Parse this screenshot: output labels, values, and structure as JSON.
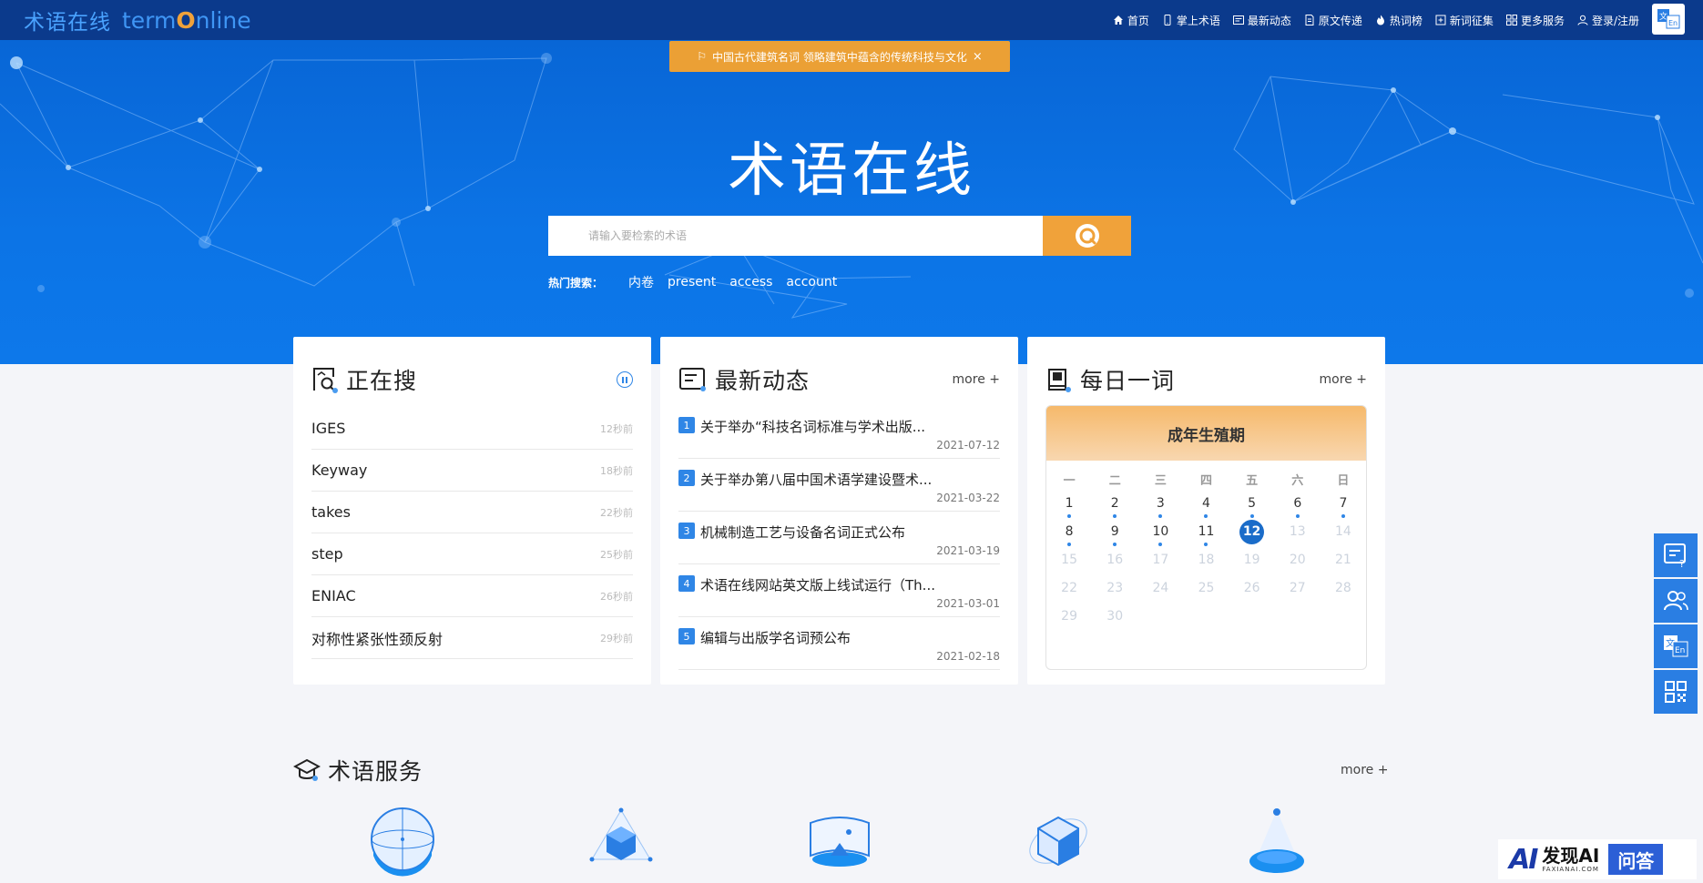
{
  "nav": {
    "logo_cn": "术语在线",
    "logo_en_a": "term",
    "logo_en_o": "O",
    "logo_en_b": "nline",
    "links": [
      {
        "label": "首页",
        "icon": "home-icon"
      },
      {
        "label": "掌上术语",
        "icon": "mobile-icon"
      },
      {
        "label": "最新动态",
        "icon": "news-icon"
      },
      {
        "label": "原文传递",
        "icon": "document-icon"
      },
      {
        "label": "热词榜",
        "icon": "fire-icon"
      },
      {
        "label": "新词征集",
        "icon": "collect-icon"
      },
      {
        "label": "更多服务",
        "icon": "grid-icon"
      },
      {
        "label": "登录/注册",
        "icon": "user-icon"
      }
    ],
    "lang_label": "文 En"
  },
  "hero": {
    "notice": "中国古代建筑名词 领略建筑中蕴含的传统科技与文化",
    "notice_close": "×",
    "title": "术语在线",
    "search_placeholder": "请输入要检索的术语",
    "hot_label": "热门搜索：",
    "hot_terms": [
      "内卷",
      "present",
      "access",
      "account"
    ]
  },
  "searching": {
    "title": "正在搜",
    "items": [
      {
        "term": "IGES",
        "time": "12秒前"
      },
      {
        "term": "Keyway",
        "time": "18秒前"
      },
      {
        "term": "takes",
        "time": "22秒前"
      },
      {
        "term": "step",
        "time": "25秒前"
      },
      {
        "term": "ENIAC",
        "time": "26秒前"
      },
      {
        "term": "对称性紧张性颈反射",
        "time": "29秒前"
      }
    ]
  },
  "news": {
    "title": "最新动态",
    "more": "more +",
    "items": [
      {
        "num": "1",
        "text": "关于举办“科技名词标准与学术出版...",
        "date": "2021-07-12"
      },
      {
        "num": "2",
        "text": "关于举办第八届中国术语学建设暨术...",
        "date": "2021-03-22"
      },
      {
        "num": "3",
        "text": "机械制造工艺与设备名词正式公布",
        "date": "2021-03-19"
      },
      {
        "num": "4",
        "text": "术语在线网站英文版上线试运行（Th...",
        "date": "2021-03-01"
      },
      {
        "num": "5",
        "text": "编辑与出版学名词预公布",
        "date": "2021-02-18"
      }
    ]
  },
  "daily": {
    "title": "每日一词",
    "more": "more +",
    "word": "成年生殖期",
    "weekdays": [
      "一",
      "二",
      "三",
      "四",
      "五",
      "六",
      "日"
    ],
    "days": [
      {
        "d": "1",
        "dot": true,
        "state": "past"
      },
      {
        "d": "2",
        "dot": true,
        "state": "past"
      },
      {
        "d": "3",
        "dot": true,
        "state": "past"
      },
      {
        "d": "4",
        "dot": true,
        "state": "past"
      },
      {
        "d": "5",
        "dot": true,
        "state": "past"
      },
      {
        "d": "6",
        "dot": true,
        "state": "past"
      },
      {
        "d": "7",
        "dot": true,
        "state": "past"
      },
      {
        "d": "8",
        "dot": true,
        "state": "past"
      },
      {
        "d": "9",
        "dot": true,
        "state": "past"
      },
      {
        "d": "10",
        "dot": true,
        "state": "past"
      },
      {
        "d": "11",
        "dot": true,
        "state": "past"
      },
      {
        "d": "12",
        "dot": false,
        "state": "today"
      },
      {
        "d": "13",
        "dot": false,
        "state": "future"
      },
      {
        "d": "14",
        "dot": false,
        "state": "future"
      },
      {
        "d": "15",
        "dot": false,
        "state": "future"
      },
      {
        "d": "16",
        "dot": false,
        "state": "future"
      },
      {
        "d": "17",
        "dot": false,
        "state": "future"
      },
      {
        "d": "18",
        "dot": false,
        "state": "future"
      },
      {
        "d": "19",
        "dot": false,
        "state": "future"
      },
      {
        "d": "20",
        "dot": false,
        "state": "future"
      },
      {
        "d": "21",
        "dot": false,
        "state": "future"
      },
      {
        "d": "22",
        "dot": false,
        "state": "future"
      },
      {
        "d": "23",
        "dot": false,
        "state": "future"
      },
      {
        "d": "24",
        "dot": false,
        "state": "future"
      },
      {
        "d": "25",
        "dot": false,
        "state": "future"
      },
      {
        "d": "26",
        "dot": false,
        "state": "future"
      },
      {
        "d": "27",
        "dot": false,
        "state": "future"
      },
      {
        "d": "28",
        "dot": false,
        "state": "future"
      },
      {
        "d": "29",
        "dot": false,
        "state": "future"
      },
      {
        "d": "30",
        "dot": false,
        "state": "future"
      }
    ]
  },
  "services": {
    "title": "术语服务",
    "more": "more +",
    "icons": [
      "globe-service-icon",
      "cube-service-icon",
      "panorama-service-icon",
      "box-service-icon",
      "beacon-service-icon"
    ]
  },
  "float_bar": [
    "feedback-icon",
    "users-icon",
    "translate-icon",
    "qrcode-icon"
  ],
  "ai_badge": {
    "mark": "AI",
    "name": "发现AI",
    "sub": "FAXIANAI.COM",
    "qa": "问答"
  },
  "colors": {
    "nav": "#0b3a8c",
    "hero": "#0c74e6",
    "accent": "#f0a23a",
    "primary": "#2f86e6"
  }
}
